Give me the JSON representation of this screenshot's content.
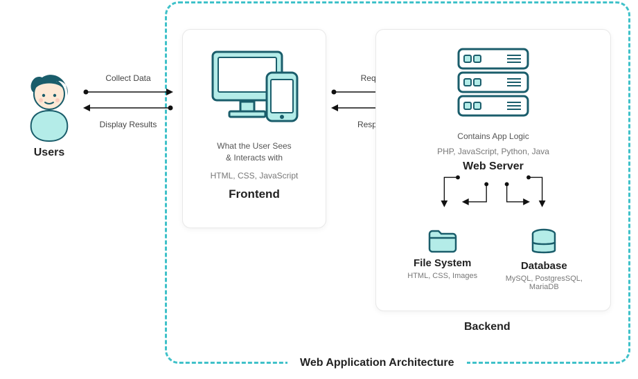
{
  "title": "Web Application Architecture",
  "users": {
    "label": "Users"
  },
  "arrows": {
    "users_frontend": {
      "top": "Collect Data",
      "bottom": "Display Results"
    },
    "frontend_backend": {
      "top": "Request",
      "bottom": "Response"
    }
  },
  "frontend": {
    "desc_line1": "What the User Sees",
    "desc_line2": "& Interacts with",
    "tech": "HTML, CSS, JavaScript",
    "title": "Frontend"
  },
  "backend": {
    "contains": "Contains App Logic",
    "tech": "PHP, JavaScript, Python, Java",
    "server_title": "Web Server",
    "file_system": {
      "title": "File System",
      "tech": "HTML, CSS, Images"
    },
    "database": {
      "title": "Database",
      "tech": "MySQL, PostgresSQL, MariaDB"
    },
    "label": "Backend"
  }
}
